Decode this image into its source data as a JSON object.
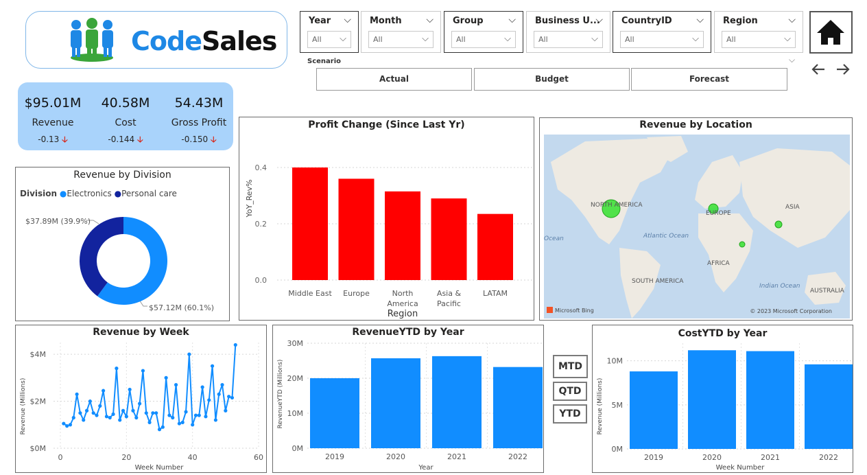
{
  "brand": {
    "name_part1": "Code",
    "name_part2": "Sales",
    "color1": "#1e88e5",
    "color2": "#111111"
  },
  "slicers": [
    {
      "label": "Year",
      "value": "All"
    },
    {
      "label": "Month",
      "value": "All"
    },
    {
      "label": "Group",
      "value": "All"
    },
    {
      "label": "Business U...",
      "value": "All"
    },
    {
      "label": "CountryID",
      "value": "All"
    },
    {
      "label": "Region",
      "value": "All"
    }
  ],
  "scenario": {
    "label": "Scenario",
    "buttons": [
      "Actual",
      "Budget",
      "Forecast"
    ]
  },
  "nav": {
    "home_icon": "home-icon",
    "back_icon": "arrow-left-icon",
    "forward_icon": "arrow-right-icon"
  },
  "kpis": [
    {
      "value": "$95.01M",
      "name": "Revenue",
      "delta": "-0.13"
    },
    {
      "value": "40.58M",
      "name": "Cost",
      "delta": "-0.144"
    },
    {
      "value": "54.43M",
      "name": "Gross Profit",
      "delta": "-0.150"
    }
  ],
  "division": {
    "title": "Revenue by Division",
    "legend_title": "Division",
    "legend": [
      "Electronics",
      "Personal care"
    ],
    "colors": [
      "#118dff",
      "#12239e"
    ],
    "label_personal": "$37.89M (39.9%)",
    "label_electronics": "$57.12M (60.1%)"
  },
  "profit_change": {
    "title": "Profit Change (Since Last Yr)",
    "ylabel": "YoY_Rev%",
    "xlabel": "Region",
    "color": "#ff0000"
  },
  "location": {
    "title": "Revenue by Location",
    "labels": {
      "na": "NORTH AMERICA",
      "europe": "EUROPE",
      "asia": "ASIA",
      "africa": "AFRICA",
      "sa": "SOUTH AMERICA",
      "australia": "AUSTRALIA",
      "atlantic": "Atlantic Ocean",
      "indian": "Indian Ocean",
      "ocean_left": "Ocean"
    },
    "attribution_left": "Microsoft Bing",
    "attribution_right": "© 2023 Microsoft Corporation"
  },
  "week_chart": {
    "title": "Revenue by Week",
    "ylabel": "Revenue (Millions)",
    "xlabel": "Week Number"
  },
  "revenue_ytd": {
    "title": "RevenueYTD by Year",
    "ylabel": "RevenueYTD (Millions)",
    "xlabel": "Year"
  },
  "cost_ytd": {
    "title": "CostYTD by Year",
    "ylabel": "Revenue (Millions)",
    "xlabel": "Week Number"
  },
  "time_buttons": [
    "MTD",
    "QTD",
    "YTD"
  ],
  "chart_data": [
    {
      "type": "pie",
      "title": "Revenue by Division",
      "categories": [
        "Electronics",
        "Personal care"
      ],
      "values": [
        57.12,
        37.89
      ],
      "percent": [
        60.1,
        39.9
      ]
    },
    {
      "type": "bar",
      "title": "Profit Change (Since Last Yr)",
      "categories": [
        "Middle East",
        "Europe",
        "North America",
        "Asia & Pacific",
        "LATAM"
      ],
      "values": [
        0.4,
        0.36,
        0.315,
        0.29,
        0.235
      ],
      "ylabel": "YoY_Rev%",
      "xlabel": "Region",
      "ylim": [
        0,
        0.4
      ],
      "yticks": [
        0.0,
        0.2,
        0.4
      ]
    },
    {
      "type": "line",
      "title": "Revenue by Week",
      "xlabel": "Week Number",
      "ylabel": "Revenue (Millions)",
      "x": [
        1,
        2,
        3,
        4,
        5,
        6,
        7,
        8,
        9,
        10,
        11,
        12,
        13,
        14,
        15,
        16,
        17,
        18,
        19,
        20,
        21,
        22,
        23,
        24,
        25,
        26,
        27,
        28,
        29,
        30,
        31,
        32,
        33,
        34,
        35,
        36,
        37,
        38,
        39,
        40,
        41,
        42,
        43,
        44,
        45,
        46,
        47,
        48,
        49,
        50,
        51,
        52,
        53
      ],
      "values": [
        1.05,
        0.95,
        1.0,
        1.3,
        2.3,
        1.5,
        1.2,
        1.6,
        2.0,
        1.5,
        1.4,
        1.8,
        2.45,
        1.35,
        1.3,
        1.45,
        3.4,
        1.2,
        1.6,
        1.35,
        2.5,
        1.6,
        1.3,
        1.9,
        3.3,
        1.5,
        1.1,
        1.5,
        1.5,
        0.8,
        0.9,
        3.0,
        1.4,
        1.3,
        2.7,
        1.05,
        1.1,
        1.55,
        4.0,
        1.0,
        1.4,
        1.4,
        2.6,
        1.35,
        2.05,
        3.5,
        1.2,
        2.3,
        2.7,
        1.6,
        2.2,
        2.15,
        4.4
      ],
      "xlim": [
        0,
        60
      ],
      "ylim": [
        0,
        4.5
      ],
      "yticks": [
        "$0M",
        "$2M",
        "$4M"
      ],
      "xticks": [
        0,
        20,
        40,
        60
      ]
    },
    {
      "type": "bar",
      "title": "RevenueYTD by Year",
      "categories": [
        "2019",
        "2020",
        "2021",
        "2022"
      ],
      "values": [
        20,
        25.7,
        26.3,
        23.2
      ],
      "xlabel": "Year",
      "ylabel": "RevenueYTD (Millions)",
      "ylim": [
        0,
        30
      ],
      "yticks": [
        "0M",
        "10M",
        "20M",
        "30M"
      ]
    },
    {
      "type": "bar",
      "title": "CostYTD by Year",
      "categories": [
        "2019",
        "2020",
        "2021",
        "2022"
      ],
      "values": [
        8.8,
        11.2,
        11.1,
        9.6
      ],
      "xlabel": "Week Number",
      "ylabel": "Revenue (Millions)",
      "ylim": [
        0,
        12
      ],
      "yticks": [
        "0M",
        "5M",
        "10M"
      ]
    }
  ]
}
